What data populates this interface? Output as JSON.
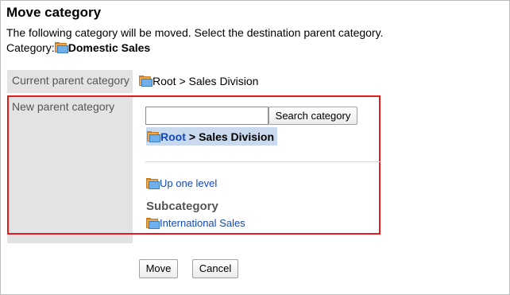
{
  "header": {
    "title": "Move category",
    "description": "The following category will be moved. Select the destination parent category.",
    "category_label": "Category:",
    "category_name": "Domestic Sales"
  },
  "current_parent": {
    "label": "Current parent category",
    "value": "Root > Sales Division"
  },
  "new_parent": {
    "label": "New parent category",
    "search_value": "",
    "search_button": "Search category",
    "path_root": "Root",
    "path_separator": ">",
    "path_current": "Sales Division",
    "up_link": "Up one level",
    "subcategory_heading": "Subcategory",
    "subcategories": [
      "International Sales"
    ]
  },
  "actions": {
    "move_label": "Move",
    "cancel_label": "Cancel"
  },
  "colors": {
    "highlight_border": "#e21c1c",
    "link": "#1448b8",
    "label_background": "#e3e3e3",
    "selected_path_background": "#c9d9ee"
  },
  "icons": [
    "folder-icon"
  ]
}
